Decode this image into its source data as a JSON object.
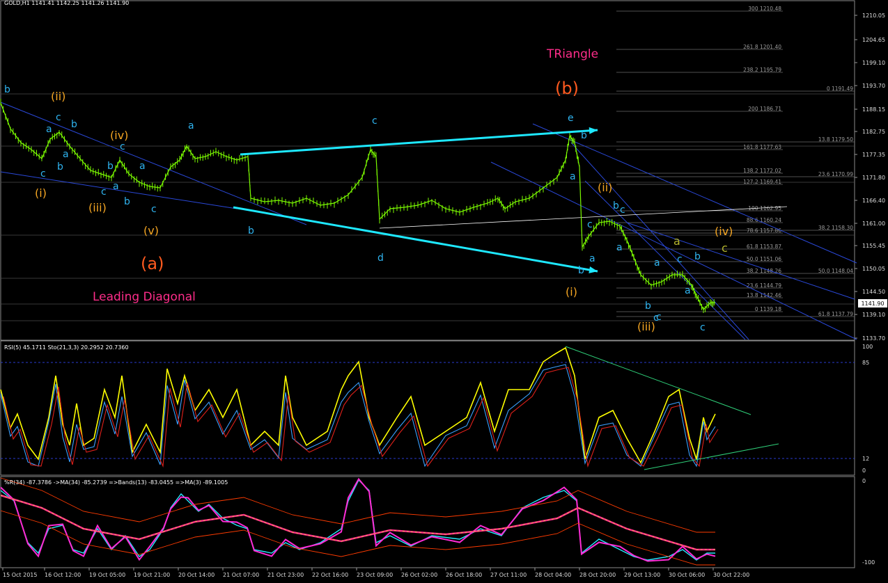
{
  "header": {
    "symbol_line": "GOLD,H1  1141.41 1142.25 1141.26 1141.90",
    "rsi_line": "RSI(5) 45.1711  Sto(21,3,3) 20.2952 20.7360",
    "wpr_line": "%R(34) -87.3786  ->MA(34) -85.2739  =>Bands(13) -83.0455  =>MA(3) -89.1005"
  },
  "colors": {
    "background": "#000000",
    "grid": "#3a3a3a",
    "price": "#7CFC00",
    "wave_blue": "#2fb4f0",
    "wave_orange": "#f5a623",
    "wave_red": "#ff5a1f",
    "pink_text": "#ff2d8a",
    "cyan_arrow": "#1ee8ff",
    "rsi": "#ffff00",
    "sto_main": "#3aa0ff",
    "sto_signal": "#e0201a",
    "wpr": "#26e8ff",
    "wpr_ma": "#ff2bd6",
    "wpr_bands": "#ff3b00",
    "wpr_ma34": "#ff2d8a",
    "channel": "#2a48d8",
    "fib": "#6b6b6b"
  },
  "price_axis": {
    "ticks": [
      "1210.05",
      "1204.65",
      "1199.10",
      "1193.70",
      "1188.15",
      "1182.75",
      "1177.35",
      "1171.80",
      "1166.40",
      "1161.00",
      "1155.45",
      "1150.05",
      "1144.50",
      "1139.10",
      "1133.70"
    ],
    "current": "1141.90"
  },
  "rsi_axis": {
    "ticks": [
      "100",
      "85",
      "12",
      "0"
    ]
  },
  "wpr_axis": {
    "ticks": [
      "0",
      "-100"
    ]
  },
  "time_axis": [
    "15 Oct 2015",
    "16 Oct 12:00",
    "19 Oct 05:00",
    "19 Oct 21:00",
    "20 Oct 14:00",
    "21 Oct 07:00",
    "21 Oct 23:00",
    "22 Oct 16:00",
    "23 Oct 09:00",
    "26 Oct 02:00",
    "26 Oct 18:00",
    "27 Oct 11:00",
    "28 Oct 04:00",
    "28 Oct 20:00",
    "29 Oct 13:00",
    "30 Oct 06:00",
    "30 Oct 22:00"
  ],
  "fib_labels": [
    "300 1210.48",
    "261.8 1201.40",
    "238.2 1195.79",
    "0 1191.49",
    "200 1186.71",
    "13.8 1179.50",
    "161.8 1177.63",
    "138.2 1172.02",
    "23.6 1170.99",
    "127.2 1169.41",
    "100 1162.95",
    "88.6 1160.24",
    "38.2 1158.30",
    "78.6 1157.86",
    "61.8 1153.87",
    "50.0 1151.06",
    "38.2 1148.26",
    "50.0 1148.04",
    "23.6 1144.79",
    "13.8 1142.46",
    "0 1139.18",
    "61.8 1137.79"
  ],
  "annotations": {
    "triangle": "TRiangle",
    "leading_diagonal": "Leading Diagonal",
    "wave_a_big": "(a)",
    "wave_b_big": "(b)"
  },
  "wave_labels_blue": [
    "b",
    "c",
    "a",
    "c",
    "b",
    "a",
    "b",
    "c",
    "b",
    "a",
    "c",
    "b",
    "a",
    "c",
    "a",
    "b",
    "c",
    "d",
    "e",
    "b",
    "a",
    "c",
    "b",
    "a",
    "c",
    "b",
    "c",
    "a",
    "a",
    "c",
    "b",
    "c",
    "b",
    "a",
    "c"
  ],
  "wave_labels_orange": [
    "(ii)",
    "(i)",
    "(iv)",
    "(iii)",
    "(v)",
    "(ii)",
    "(i)",
    "(iv)",
    "(iii)"
  ],
  "wave_labels_olive": [
    "a",
    "c"
  ],
  "chart_data": {
    "type": "line",
    "title": "GOLD,H1",
    "ohlc_last": {
      "open": 1141.41,
      "high": 1142.25,
      "low": 1141.26,
      "close": 1141.9
    },
    "x": [
      "15 Oct 2015",
      "16 Oct 12:00",
      "19 Oct 05:00",
      "19 Oct 21:00",
      "20 Oct 14:00",
      "21 Oct 07:00",
      "21 Oct 23:00",
      "22 Oct 16:00",
      "23 Oct 09:00",
      "26 Oct 02:00",
      "26 Oct 18:00",
      "27 Oct 11:00",
      "28 Oct 04:00",
      "28 Oct 20:00",
      "29 Oct 13:00",
      "30 Oct 06:00",
      "30 Oct 22:00"
    ],
    "series": [
      {
        "name": "GOLD,H1",
        "values": [
          1188.5,
          1178,
          1172,
          1169,
          1176,
          1172,
          1164,
          1164,
          1174,
          1165,
          1166,
          1168,
          1183,
          1156,
          1148,
          1140,
          1141.9
        ]
      },
      {
        "name": "RSI(5)",
        "values": [
          60,
          20,
          75,
          30,
          70,
          35,
          60,
          30,
          80,
          40,
          55,
          60,
          100,
          20,
          40,
          65,
          45.17
        ]
      },
      {
        "name": "Sto(21,3,3)",
        "values": [
          55,
          15,
          60,
          20,
          70,
          20,
          40,
          15,
          85,
          20,
          30,
          40,
          95,
          35,
          15,
          25,
          20.3
        ]
      },
      {
        "name": "%R(34)",
        "values": [
          -5,
          -85,
          -70,
          -80,
          -25,
          -55,
          -85,
          -60,
          -15,
          -70,
          -65,
          -55,
          -5,
          -70,
          -90,
          -85,
          -87.38
        ]
      }
    ],
    "ylim": [
      1133.7,
      1212.0
    ]
  }
}
